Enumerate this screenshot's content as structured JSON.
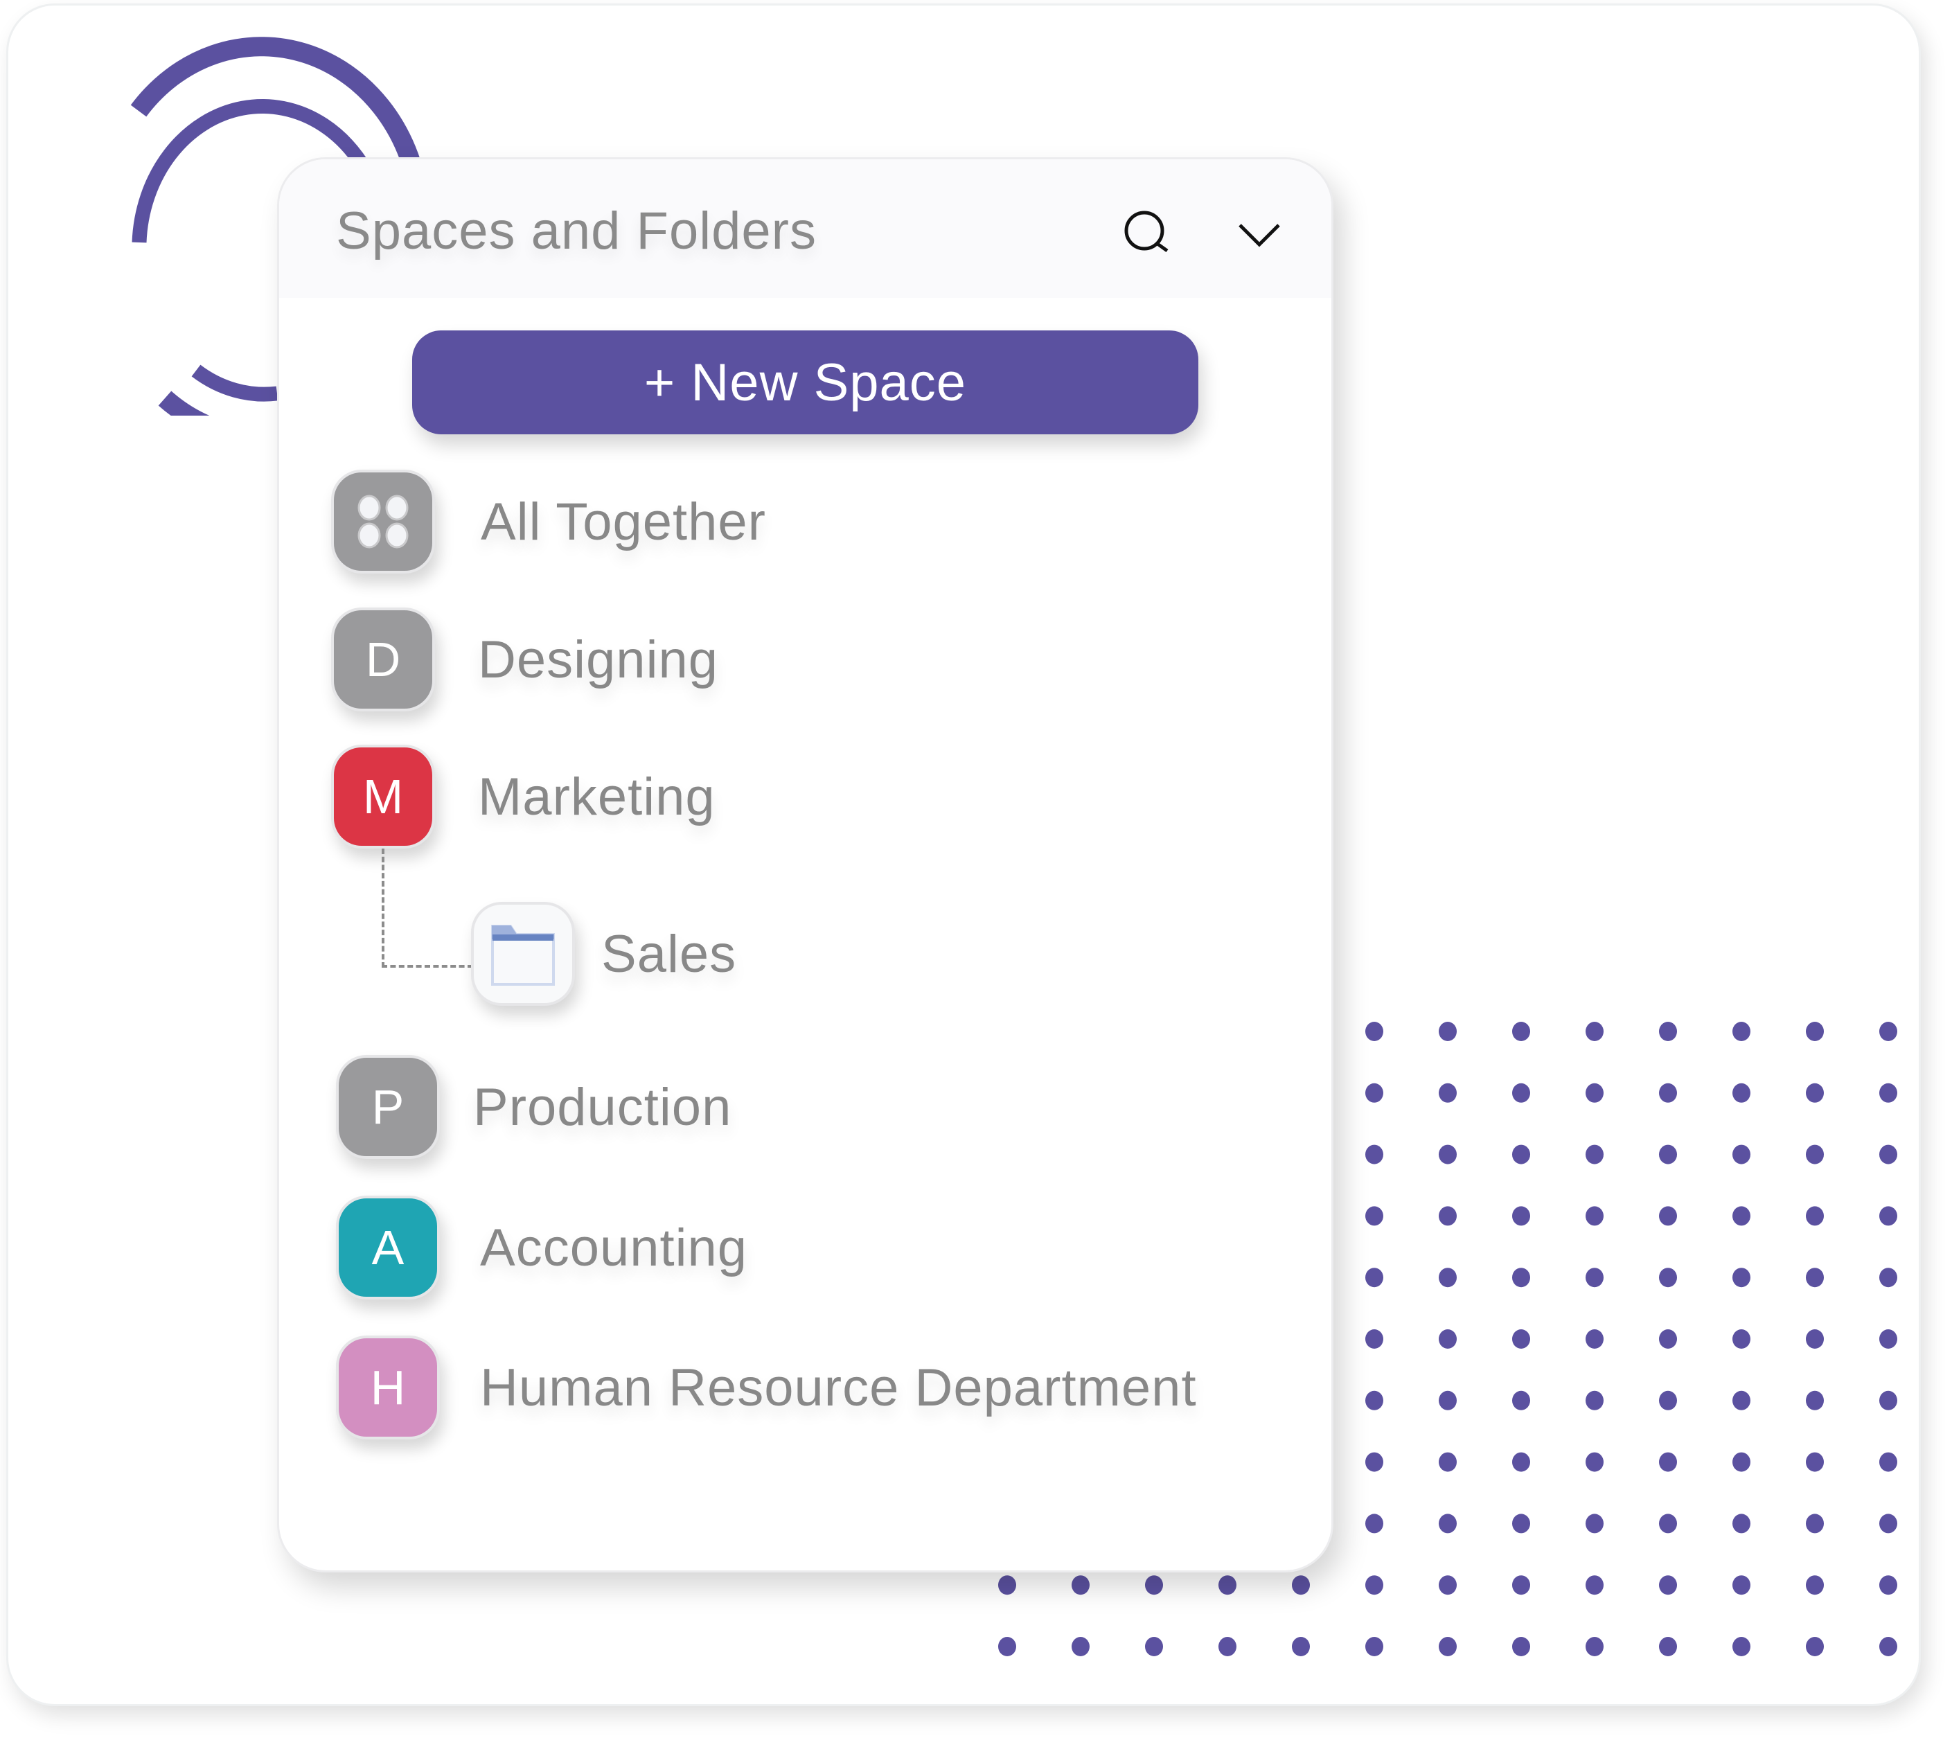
{
  "panel": {
    "title": "Spaces and Folders",
    "search_icon": "search-icon",
    "collapse_icon": "chevron-down-icon"
  },
  "new_space_button": {
    "label": "+ New Space",
    "color": "#5b51a0"
  },
  "spaces": [
    {
      "name": "All Together",
      "initial": "",
      "icon": "grid-dots-icon",
      "color": "#9a9a9c"
    },
    {
      "name": "Designing",
      "initial": "D",
      "color": "#9a9a9c"
    },
    {
      "name": "Marketing",
      "initial": "M",
      "color": "#dc3545",
      "folders": [
        {
          "name": "Sales",
          "icon": "folder-icon"
        }
      ]
    },
    {
      "name": "Production",
      "initial": "P",
      "color": "#9a9a9c"
    },
    {
      "name": "Accounting",
      "initial": "A",
      "color": "#1fa5b3"
    },
    {
      "name": "Human Resource Department",
      "initial": "H",
      "color": "#d38fc1"
    }
  ],
  "decoration": {
    "accent_color": "#5b51a0"
  }
}
